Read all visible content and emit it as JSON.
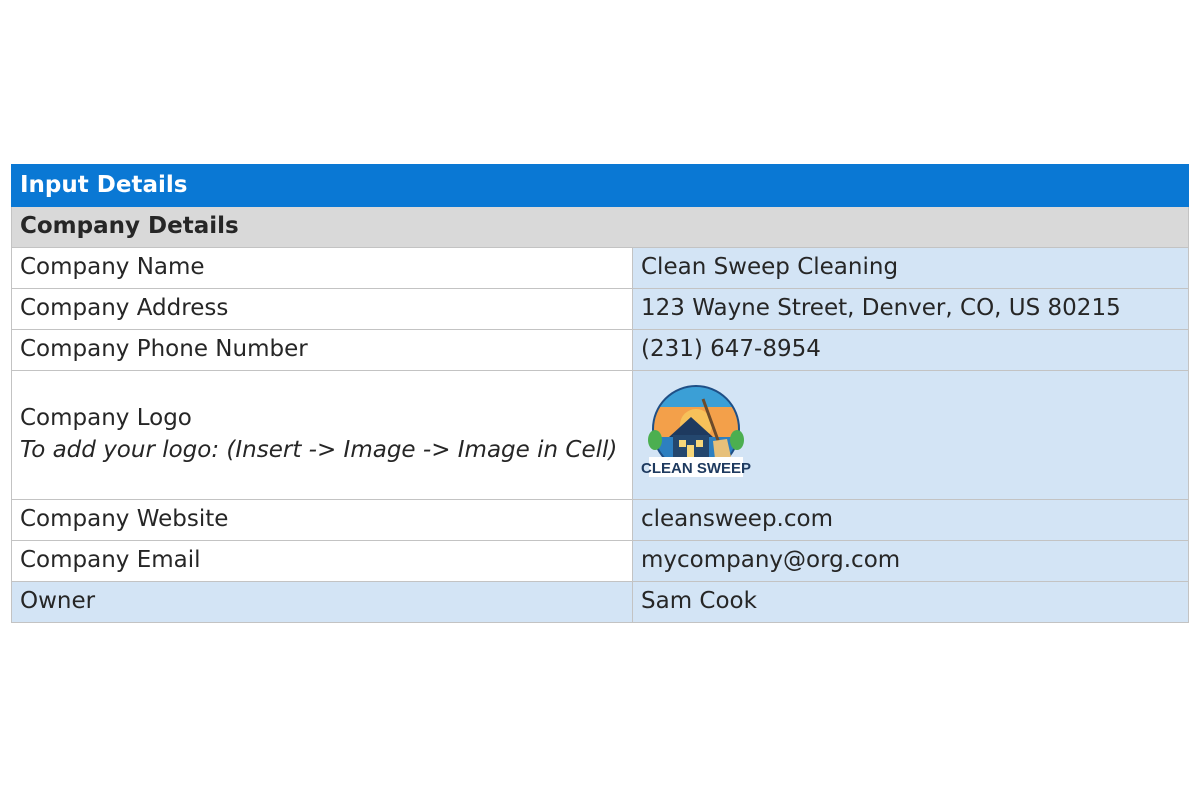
{
  "sheet": {
    "title": "Input Details",
    "section": "Company Details",
    "rows": [
      {
        "label": "Company Name",
        "value": "Clean Sweep Cleaning"
      },
      {
        "label": "Company Address",
        "value": "123 Wayne Street, Denver, CO, US 80215"
      },
      {
        "label": "Company Phone Number",
        "value": "(231) 647-8954"
      }
    ],
    "logo_row": {
      "label": "Company Logo",
      "hint": "To add your logo: (Insert -> Image -> Image in Cell)",
      "logo_text": "CLEAN SWEEP",
      "logo_icon": "house-broom-logo"
    },
    "rows2": [
      {
        "label": "Company Website",
        "value": "cleansweep.com"
      },
      {
        "label": "Company Email",
        "value": "mycompany@org.com"
      },
      {
        "label": "Owner",
        "value": "Sam Cook"
      }
    ]
  },
  "colors": {
    "header_blue": "#0a78d4",
    "section_gray": "#d9d9d9",
    "value_blue": "#d3e4f5"
  }
}
